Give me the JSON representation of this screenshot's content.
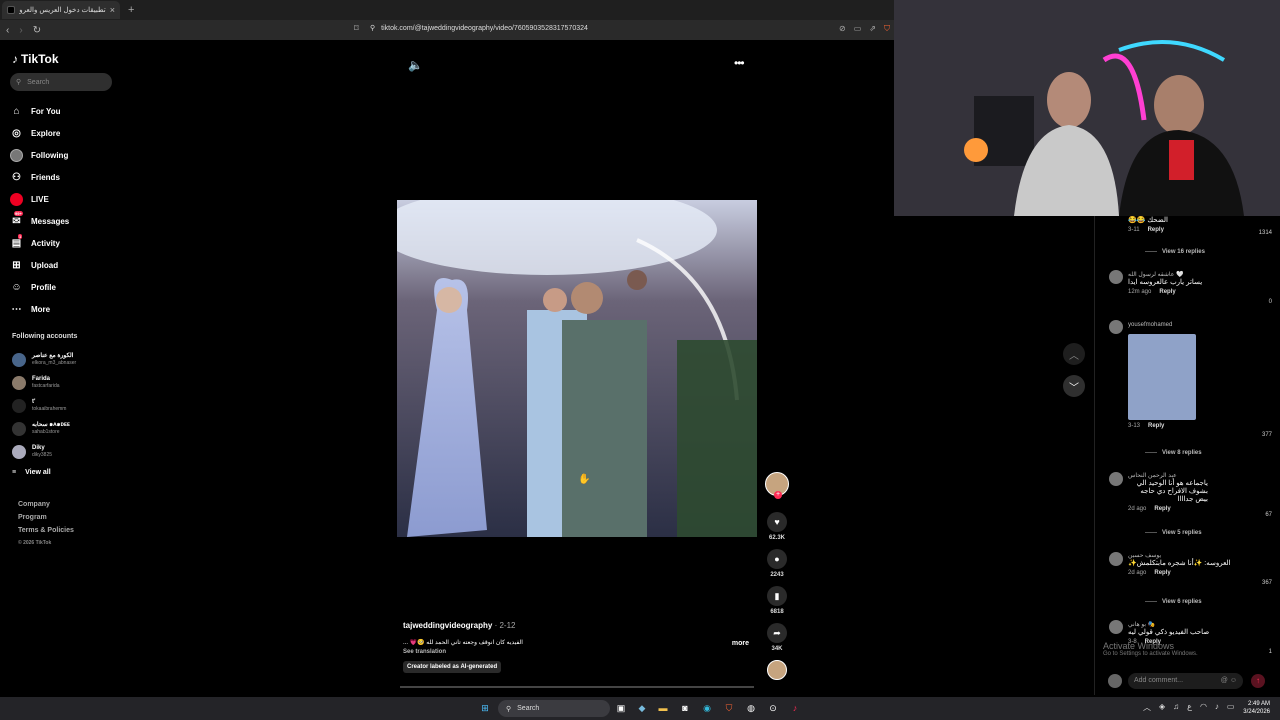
{
  "browser": {
    "tab_title": "تطبيقات دخول العريس والعروسة...",
    "tab_close": "×",
    "new_tab": "+",
    "url": "tiktok.com/@tajweddingvideography/video/7605903528317570324"
  },
  "sidebar": {
    "logo": "TikTok",
    "search_placeholder": "Search",
    "nav": [
      {
        "label": "For You",
        "icon": "home-icon"
      },
      {
        "label": "Explore",
        "icon": "compass-icon"
      },
      {
        "label": "Following",
        "icon": "avatar-icon"
      },
      {
        "label": "Friends",
        "icon": "friends-icon"
      },
      {
        "label": "LIVE",
        "icon": "live-icon"
      },
      {
        "label": "Messages",
        "icon": "messages-icon",
        "badge": "99+"
      },
      {
        "label": "Activity",
        "icon": "activity-icon",
        "badge": "1"
      },
      {
        "label": "Upload",
        "icon": "upload-icon"
      },
      {
        "label": "Profile",
        "icon": "profile-icon"
      },
      {
        "label": "More",
        "icon": "more-icon"
      }
    ],
    "following_title": "Following accounts",
    "following": [
      {
        "name": "الكورة مع عناصر",
        "handle": "elkora_m3_abnaser"
      },
      {
        "name": "Farida",
        "handle": "fastcarfarida"
      },
      {
        "name": "t'",
        "handle": "tokaaibrahemm"
      },
      {
        "name": "سحابه ๑ᴀ๑ᴅᴇᴇ",
        "handle": "sahab1store"
      },
      {
        "name": "Diky",
        "handle": "diky3825"
      }
    ],
    "view_all": "View all",
    "footer": [
      "Company",
      "Program",
      "Terms & Policies"
    ],
    "copyright": "© 2026 TikTok"
  },
  "video": {
    "username": "tajweddingvideography",
    "date": "· 2-12",
    "description": "الفيديه كان انوقف وجعته تاني الحمد لله 🥺💗 ...",
    "more": "more",
    "see_translation": "See translation",
    "ai_label": "Creator labeled as AI-generated",
    "likes": "62.3K",
    "comments": "2243",
    "saves": "6818",
    "shares": "34K",
    "progress": 0.0
  },
  "comments": {
    "items": [
      {
        "text": "الضحك 😂😂",
        "date": "3-11",
        "reply": "Reply",
        "likes": "1314",
        "view_replies": "View 16 replies"
      },
      {
        "name": "عاشقه لرسول الله 🤍",
        "text": "يساتر يارب عالعروسه ايدا",
        "date": "12m ago",
        "reply": "Reply",
        "likes": "0"
      },
      {
        "name": "yousefmohamed",
        "text": "",
        "date": "3-13",
        "reply": "Reply",
        "likes": "377",
        "view_replies": "View 8 replies"
      },
      {
        "name": "عبد الرحمن النحاس",
        "text": "ياجماعه هو أنا الوحيد الي بشوف الافراح دي حاجه بيض جداااا",
        "date": "2d ago",
        "reply": "Reply",
        "likes": "67",
        "view_replies": "View 5 replies"
      },
      {
        "name": "يوسف حسين",
        "text": "العروسه: ✨أنا شجره مابتكلمش✨",
        "date": "2d ago",
        "reply": "Reply",
        "likes": "367",
        "view_replies": "View 6 replies"
      },
      {
        "name": "بو هاني 🎭",
        "text": "صاحب الفيديو ذكي قولي ليه",
        "date": "3-8",
        "reply": "Reply",
        "likes": "1"
      }
    ],
    "add_placeholder": "Add comment...",
    "activate_title": "Activate Windows",
    "activate_sub": "Go to Settings to activate Windows."
  },
  "taskbar": {
    "search": "Search",
    "time": "2:49 AM",
    "date": "3/24/2026"
  },
  "colors": {
    "tiktok_pink": "#fe2c55",
    "background": "#000000",
    "taskbar": "#242428"
  }
}
